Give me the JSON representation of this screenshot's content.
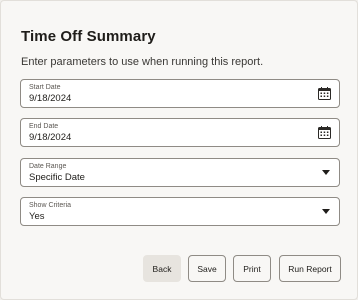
{
  "page": {
    "title": "Time Off Summary",
    "subtitle": "Enter parameters to use when running this report."
  },
  "fields": {
    "start_date": {
      "label": "Start Date",
      "value": "9/18/2024",
      "icon": "calendar-icon"
    },
    "end_date": {
      "label": "End Date",
      "value": "9/18/2024",
      "icon": "calendar-icon"
    },
    "date_range": {
      "label": "Date Range",
      "value": "Specific Date",
      "icon": "chevron-down-icon"
    },
    "show_criteria": {
      "label": "Show Criteria",
      "value": "Yes",
      "icon": "chevron-down-icon"
    }
  },
  "buttons": {
    "back": "Back",
    "save": "Save",
    "print": "Print",
    "run_report": "Run Report"
  }
}
